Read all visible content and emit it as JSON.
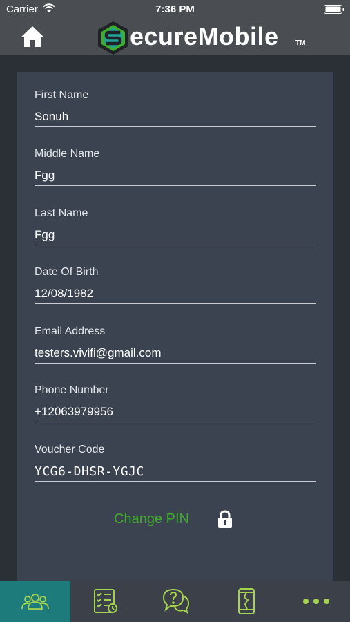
{
  "status_bar": {
    "carrier": "Carrier",
    "time": "7:36 PM"
  },
  "header": {
    "logo_text": "ecureMobile",
    "logo_tm": "TM"
  },
  "form": {
    "fields": [
      {
        "label": "First Name",
        "value": "Sonuh"
      },
      {
        "label": "Middle Name",
        "value": "Fgg"
      },
      {
        "label": "Last Name",
        "value": "Fgg"
      },
      {
        "label": "Date Of Birth",
        "value": "12/08/1982"
      },
      {
        "label": "Email Address",
        "value": "testers.vivifi@gmail.com"
      },
      {
        "label": "Phone Number",
        "value": "+12063979956"
      },
      {
        "label": "Voucher Code",
        "value": "YCG6-DHSR-YGJC"
      }
    ],
    "change_pin": "Change PIN"
  },
  "tabbar": {
    "tabs": [
      "users-icon",
      "checklist-icon",
      "help-chat-icon",
      "broken-phone-icon",
      "more-icon"
    ],
    "active_index": 0
  },
  "colors": {
    "accent_green": "#3fae2a",
    "icon_green": "#a6d34f",
    "active_tab": "#1e7b7b",
    "card": "#3c4350",
    "header": "#4a4d52"
  }
}
